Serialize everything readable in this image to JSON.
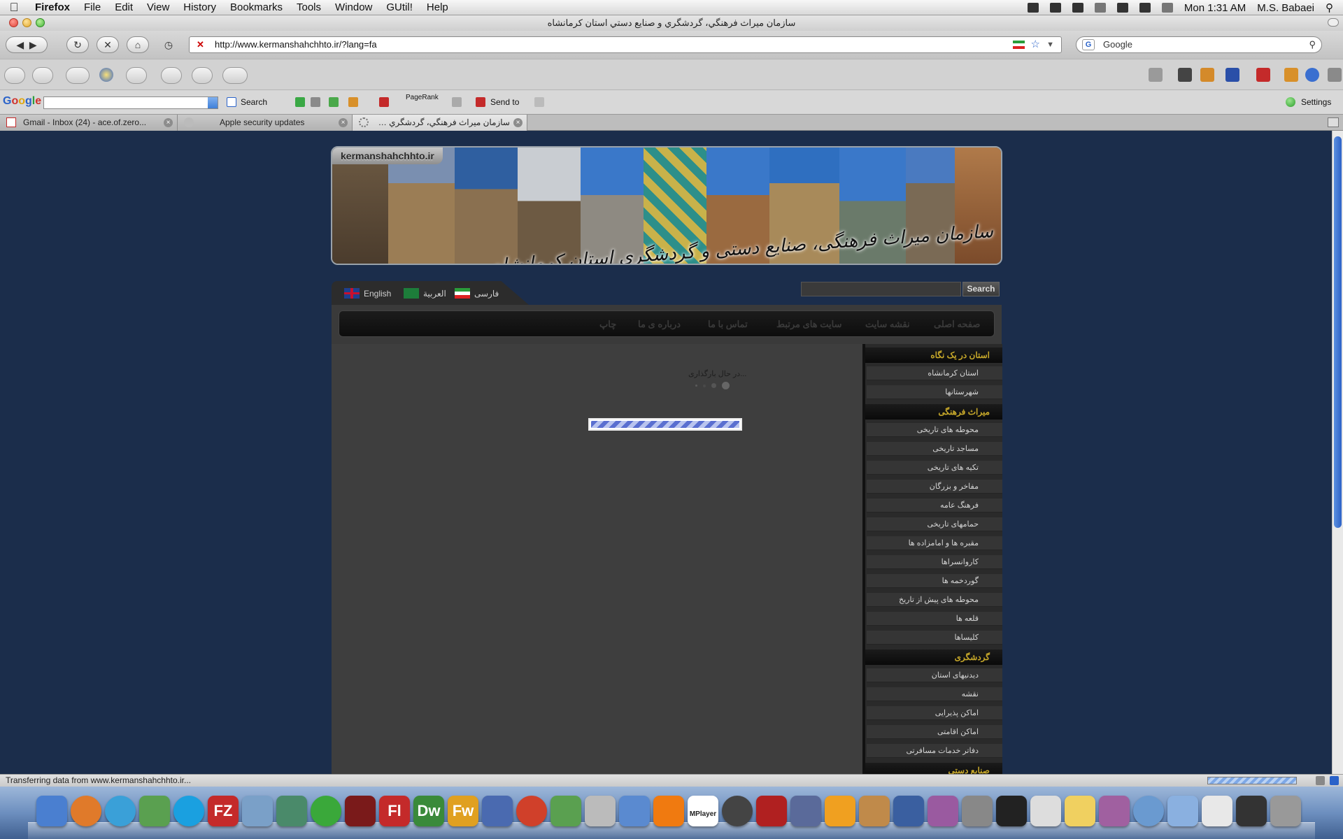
{
  "menubar": {
    "app": "Firefox",
    "items": [
      "File",
      "Edit",
      "View",
      "History",
      "Bookmarks",
      "Tools",
      "Window",
      "GUtil!",
      "Help"
    ],
    "clock": "Mon 1:31 AM",
    "user": "M.S. Babaei"
  },
  "window": {
    "title": "سازمان میراث فرهنگي، گردشگري و صنایع دستي استان کرمانشاه"
  },
  "navbar": {
    "url": "http://www.kermanshahchhto.ir/?lang=fa",
    "search_placeholder": "Google"
  },
  "google_toolbar": {
    "logo": "Google",
    "search_label": "Search",
    "pagerank_label": "PageRank",
    "send_to_label": "Send to",
    "settings_label": "Settings"
  },
  "tabs": [
    {
      "label": "Gmail - Inbox (24) - ace.of.zero...",
      "active": false
    },
    {
      "label": "Apple security updates",
      "active": false
    },
    {
      "label": "سازمان میراث فرهنگي، گردشگري و ...",
      "active": true
    }
  ],
  "site": {
    "domain_label": "kermanshahchhto.ir",
    "banner_title": "سازمان میراث فرهنگی، صنایع دستی و گردشگری استان کرمانشاه",
    "languages": [
      {
        "label": "English",
        "flag": "uk"
      },
      {
        "label": "العربية",
        "flag": "sa"
      },
      {
        "label": "فارسی",
        "flag": "ir"
      }
    ],
    "search_button": "Search",
    "nav": [
      "صفحه اصلی",
      "نقشه سایت",
      "سایت های مرتبط",
      "تماس با ما",
      "درباره ی ما",
      "چاپ"
    ],
    "loading_text": "در حال بارگذاری...",
    "loading_progress": 1.0,
    "sidebar": {
      "sections": [
        {
          "title": "استان در یک نگاه",
          "items": [
            "استان کرمانشاه",
            "شهرستانها"
          ]
        },
        {
          "title": "میراث فرهنگی",
          "items": [
            "محوطه های تاریخی",
            "مساجد تاریخی",
            "تکیه های تاریخی",
            "مفاخر و بزرگان",
            "فرهنگ عامه",
            "حمامهای تاریخی",
            "مقبره ها و امامزاده ها",
            "کاروانسراها",
            "گوردخمه ها",
            "محوطه های پیش از تاریخ",
            "قلعه ها",
            "کلیساها"
          ]
        },
        {
          "title": "گردشگری",
          "items": [
            "دیدنیهای استان",
            "نقشه",
            "اماکن پذیرایی",
            "اماکن اقامتی",
            "دفاتر خدمات مسافرتی"
          ]
        },
        {
          "title": "صنایع دستی",
          "items": []
        }
      ]
    }
  },
  "statusbar": {
    "text": "Transferring data from www.kermanshahchhto.ir..."
  },
  "dock": {
    "icons": [
      "finder-icon",
      "firefox-icon",
      "safari-icon",
      "app-icon",
      "skype-icon",
      "filezilla-icon",
      "app-icon",
      "app-icon",
      "utorrent-icon",
      "app-icon",
      "flash-icon",
      "dreamweaver-icon",
      "fireworks-icon",
      "app-icon",
      "windows-icon",
      "app-icon",
      "dvd-icon",
      "itunes-icon",
      "vlc-icon",
      "mplayer-icon",
      "quicktime-icon",
      "app-icon",
      "app-icon",
      "app-icon",
      "app-icon",
      "app-icon",
      "app-icon",
      "system-preferences-icon",
      "terminal-icon",
      "app-icon",
      "stickies-icon",
      "app-icon",
      "app-icon",
      "folder-icon",
      "app-icon",
      "app-icon",
      "trash-icon"
    ],
    "labels": {
      "filezilla": "FZ",
      "flash": "Fl",
      "dreamweaver": "Dw",
      "fireworks": "Fw",
      "mplayer": "MPlayer"
    }
  },
  "colors": {
    "page_bg": "#1b2d4b",
    "sidebar_heading": "#c7a82a",
    "content_bg": "#3e3e3e"
  }
}
